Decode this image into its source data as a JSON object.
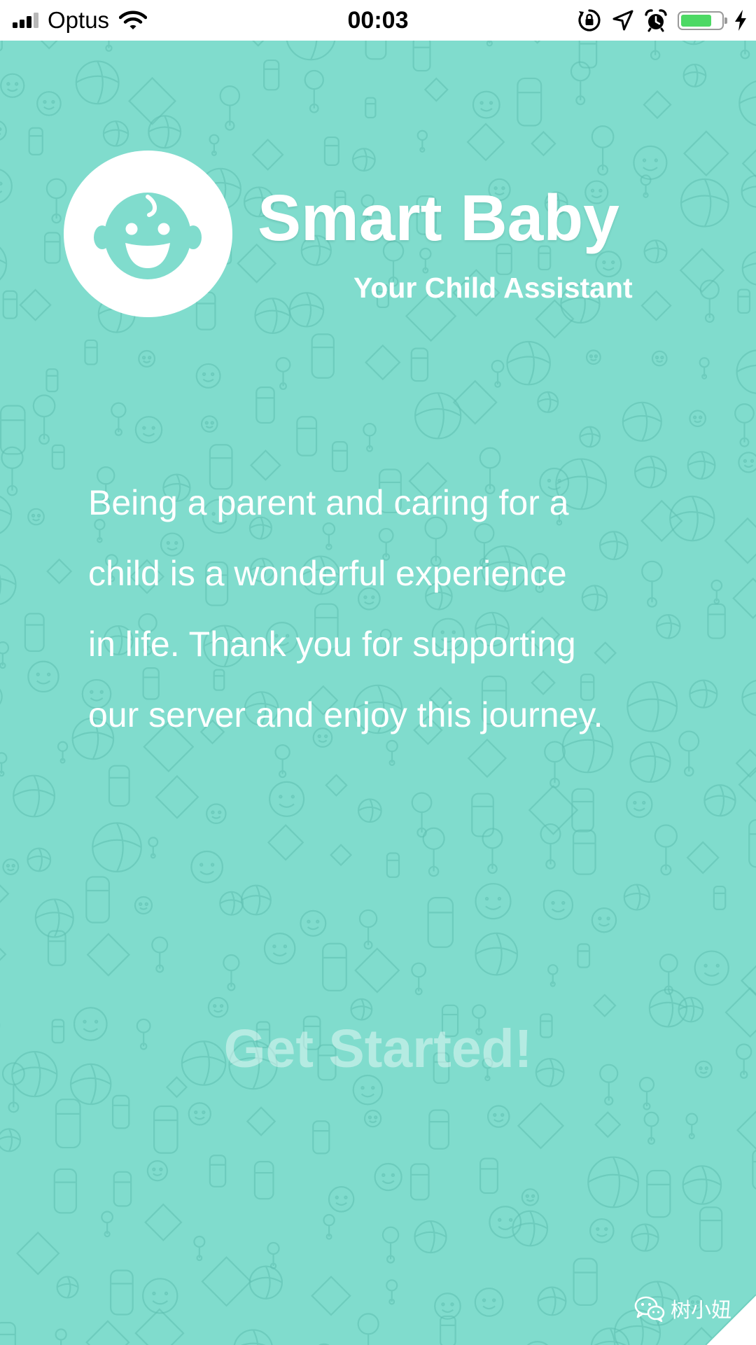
{
  "status_bar": {
    "carrier": "Optus",
    "time": "00:03",
    "signal_bars_filled": 3,
    "signal_bars_total": 4,
    "battery_level": 0.8,
    "icons": [
      "cellular-signal-icon",
      "wifi-icon",
      "orientation-lock-icon",
      "location-arrow-icon",
      "alarm-clock-icon",
      "battery-icon",
      "charging-bolt-icon"
    ]
  },
  "header": {
    "logo_icon": "baby-face-icon",
    "title": "Smart Baby",
    "subtitle": "Your Child Assistant"
  },
  "intro": {
    "lines": [
      "Being a parent and caring for a",
      "child is a wonderful experience",
      "in life. Thank you for supporting",
      "our server and enjoy this journey."
    ]
  },
  "cta": {
    "label": "Get Started!"
  },
  "watermark": {
    "icon": "wechat-icon",
    "text": "树小妞"
  },
  "colors": {
    "background": "#80dccd",
    "doodle": "#5fbfb1",
    "text": "#ffffff",
    "battery_fill": "#4cd964",
    "status_bar": "#ffffff"
  }
}
